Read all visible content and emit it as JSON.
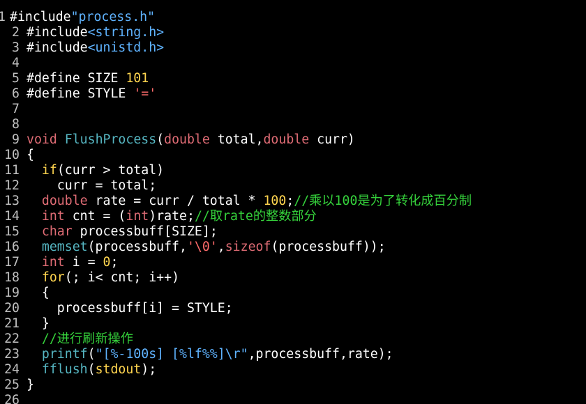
{
  "window": {
    "title": ""
  },
  "colors": {
    "background": "#000000",
    "plain": "#ffffff",
    "line_number": "#bfbfbf",
    "preproc": "#ffffff",
    "string": "#5fb3ff",
    "keyword": "#e06c75",
    "type": "#e06c75",
    "function": "#56b6c2",
    "comment": "#35d13b",
    "number": "#ffd54f",
    "builtin": "#56b6c2",
    "char": "#ff6b6b",
    "stdio": "#ffd54f"
  },
  "lines": [
    {
      "n": "1",
      "tokens": [
        {
          "t": "#include",
          "c": "preproc"
        },
        {
          "t": "\"process.h\"",
          "c": "string"
        }
      ]
    },
    {
      "n": "2",
      "tokens": [
        {
          "t": "#include",
          "c": "preproc"
        },
        {
          "t": "<string.h>",
          "c": "string"
        }
      ]
    },
    {
      "n": "3",
      "tokens": [
        {
          "t": "#include",
          "c": "preproc"
        },
        {
          "t": "<unistd.h>",
          "c": "string"
        }
      ]
    },
    {
      "n": "4",
      "tokens": []
    },
    {
      "n": "5",
      "tokens": [
        {
          "t": "#define SIZE ",
          "c": "preproc"
        },
        {
          "t": "101",
          "c": "number"
        }
      ]
    },
    {
      "n": "6",
      "tokens": [
        {
          "t": "#define STYLE ",
          "c": "preproc"
        },
        {
          "t": "'='",
          "c": "char"
        }
      ]
    },
    {
      "n": "7",
      "tokens": []
    },
    {
      "n": "8",
      "tokens": []
    },
    {
      "n": "9",
      "tokens": [
        {
          "t": "void",
          "c": "keyword"
        },
        {
          "t": " ",
          "c": "plain"
        },
        {
          "t": "FlushProcess",
          "c": "function"
        },
        {
          "t": "(",
          "c": "plain"
        },
        {
          "t": "double",
          "c": "type"
        },
        {
          "t": " total,",
          "c": "plain"
        },
        {
          "t": "double",
          "c": "type"
        },
        {
          "t": " curr)",
          "c": "plain"
        }
      ]
    },
    {
      "n": "10",
      "tokens": [
        {
          "t": "{",
          "c": "plain"
        }
      ]
    },
    {
      "n": "11",
      "tokens": [
        {
          "t": "  ",
          "c": "plain"
        },
        {
          "t": "if",
          "c": "stdio"
        },
        {
          "t": "(curr > total)",
          "c": "plain"
        }
      ]
    },
    {
      "n": "12",
      "tokens": [
        {
          "t": "    curr = total;",
          "c": "plain"
        }
      ]
    },
    {
      "n": "13",
      "tokens": [
        {
          "t": "  ",
          "c": "plain"
        },
        {
          "t": "double",
          "c": "type"
        },
        {
          "t": " rate = curr / total * ",
          "c": "plain"
        },
        {
          "t": "100",
          "c": "number"
        },
        {
          "t": ";",
          "c": "plain"
        },
        {
          "t": "//乘以100是为了转化成百分制",
          "c": "comment"
        }
      ]
    },
    {
      "n": "14",
      "tokens": [
        {
          "t": "  ",
          "c": "plain"
        },
        {
          "t": "int",
          "c": "type"
        },
        {
          "t": " cnt = (",
          "c": "plain"
        },
        {
          "t": "int",
          "c": "type"
        },
        {
          "t": ")rate;",
          "c": "plain"
        },
        {
          "t": "//取rate的整数部分",
          "c": "comment"
        }
      ]
    },
    {
      "n": "15",
      "tokens": [
        {
          "t": "  ",
          "c": "plain"
        },
        {
          "t": "char",
          "c": "type"
        },
        {
          "t": " processbuff[SIZE];",
          "c": "plain"
        }
      ]
    },
    {
      "n": "16",
      "tokens": [
        {
          "t": "  ",
          "c": "plain"
        },
        {
          "t": "memset",
          "c": "builtin"
        },
        {
          "t": "(processbuff,",
          "c": "plain"
        },
        {
          "t": "'\\0'",
          "c": "char"
        },
        {
          "t": ",",
          "c": "plain"
        },
        {
          "t": "sizeof",
          "c": "keyword"
        },
        {
          "t": "(processbuff));",
          "c": "plain"
        }
      ]
    },
    {
      "n": "17",
      "tokens": [
        {
          "t": "  ",
          "c": "plain"
        },
        {
          "t": "int",
          "c": "type"
        },
        {
          "t": " i = ",
          "c": "plain"
        },
        {
          "t": "0",
          "c": "number"
        },
        {
          "t": ";",
          "c": "plain"
        }
      ]
    },
    {
      "n": "18",
      "tokens": [
        {
          "t": "  ",
          "c": "plain"
        },
        {
          "t": "for",
          "c": "stdio"
        },
        {
          "t": "(; i< cnt; i++)",
          "c": "plain"
        }
      ]
    },
    {
      "n": "19",
      "tokens": [
        {
          "t": "  {",
          "c": "plain"
        }
      ]
    },
    {
      "n": "20",
      "tokens": [
        {
          "t": "    processbuff[i] = STYLE;",
          "c": "plain"
        }
      ]
    },
    {
      "n": "21",
      "tokens": [
        {
          "t": "  }",
          "c": "plain"
        }
      ]
    },
    {
      "n": "22",
      "tokens": [
        {
          "t": "  ",
          "c": "plain"
        },
        {
          "t": "//进行刷新操作",
          "c": "comment"
        }
      ]
    },
    {
      "n": "23",
      "tokens": [
        {
          "t": "  ",
          "c": "plain"
        },
        {
          "t": "printf",
          "c": "builtin"
        },
        {
          "t": "(",
          "c": "plain"
        },
        {
          "t": "\"[%-100s] [%lf%%]\\r\"",
          "c": "string"
        },
        {
          "t": ",processbuff,rate);",
          "c": "plain"
        }
      ]
    },
    {
      "n": "24",
      "tokens": [
        {
          "t": "  ",
          "c": "plain"
        },
        {
          "t": "fflush",
          "c": "builtin"
        },
        {
          "t": "(",
          "c": "plain"
        },
        {
          "t": "stdout",
          "c": "stdio"
        },
        {
          "t": ");",
          "c": "plain"
        }
      ]
    },
    {
      "n": "25",
      "tokens": [
        {
          "t": "}",
          "c": "plain"
        }
      ]
    },
    {
      "n": "26",
      "tokens": []
    }
  ]
}
